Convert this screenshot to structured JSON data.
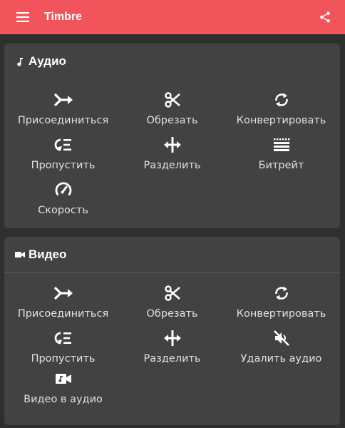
{
  "appbar": {
    "title": "Timbre",
    "menu_icon": "hamburger-menu-icon",
    "share_icon": "share-icon",
    "color": "#f2545b"
  },
  "audio": {
    "title": "Аудио",
    "icon": "music-note-icon",
    "tools": [
      {
        "label": "Присоединиться",
        "icon": "merge-icon"
      },
      {
        "label": "Обрезать",
        "icon": "scissors-icon"
      },
      {
        "label": "Конвертировать",
        "icon": "convert-icon"
      },
      {
        "label": "Пропустить",
        "icon": "omit-icon"
      },
      {
        "label": "Разделить",
        "icon": "split-icon"
      },
      {
        "label": "Битрейт",
        "icon": "bitrate-icon"
      },
      {
        "label": "Скорость",
        "icon": "speed-icon"
      }
    ]
  },
  "video": {
    "title": "Видео",
    "icon": "video-camera-icon",
    "tools": [
      {
        "label": "Присоединиться",
        "icon": "merge-icon"
      },
      {
        "label": "Обрезать",
        "icon": "scissors-icon"
      },
      {
        "label": "Конвертировать",
        "icon": "convert-icon"
      },
      {
        "label": "Пропустить",
        "icon": "omit-icon"
      },
      {
        "label": "Разделить",
        "icon": "split-icon"
      },
      {
        "label": "Удалить аудио",
        "icon": "mute-icon"
      },
      {
        "label": "Видео в аудио",
        "icon": "video-to-audio-icon"
      }
    ]
  },
  "colors": {
    "background": "#2f2f2f",
    "card": "#424242",
    "text": "#e0e0e0"
  }
}
